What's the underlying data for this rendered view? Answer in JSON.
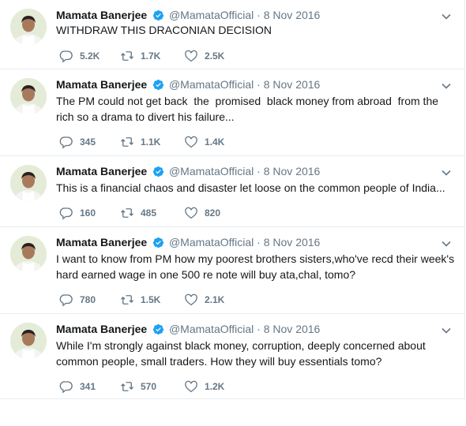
{
  "tweets": [
    {
      "name": "Mamata Banerjee",
      "handle": "@MamataOfficial",
      "sep": "·",
      "date": "8 Nov 2016",
      "text": "WITHDRAW THIS DRACONIAN DECISION",
      "replies": "5.2K",
      "retweets": "1.7K",
      "likes": "2.5K"
    },
    {
      "name": "Mamata Banerjee",
      "handle": "@MamataOfficial",
      "sep": "·",
      "date": "8 Nov 2016",
      "text": "The PM could not get back  the  promised  black money from abroad  from the rich so a drama to divert his failure...",
      "replies": "345",
      "retweets": "1.1K",
      "likes": "1.4K"
    },
    {
      "name": "Mamata Banerjee",
      "handle": "@MamataOfficial",
      "sep": "·",
      "date": "8 Nov 2016",
      "text": "This is a financial chaos and disaster let loose on the common people of India...",
      "replies": "160",
      "retweets": "485",
      "likes": "820"
    },
    {
      "name": "Mamata Banerjee",
      "handle": "@MamataOfficial",
      "sep": "·",
      "date": "8 Nov 2016",
      "text": "I want to know from PM how my poorest brothers sisters,who've recd their week's hard earned wage in one 500 re note will buy ata,chal, tomo?",
      "replies": "780",
      "retweets": "1.5K",
      "likes": "2.1K"
    },
    {
      "name": "Mamata Banerjee",
      "handle": "@MamataOfficial",
      "sep": "·",
      "date": "8 Nov 2016",
      "text": "While I'm strongly against black money, corruption, deeply concerned about common people, small traders. How they will buy essentials tomo?",
      "replies": "341",
      "retweets": "570",
      "likes": "1.2K"
    }
  ],
  "colors": {
    "verified": "#1da1f2",
    "muted": "#657786",
    "divider": "#e6ecf0"
  },
  "icons": [
    "verified-badge-icon",
    "chevron-down-icon",
    "reply-icon",
    "retweet-icon",
    "like-icon"
  ]
}
